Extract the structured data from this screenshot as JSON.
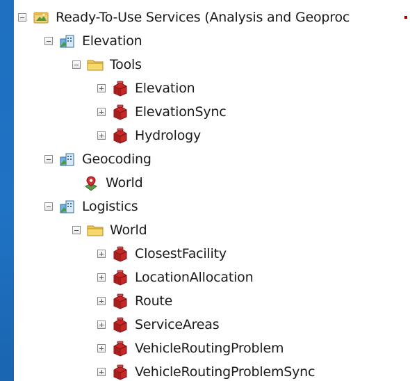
{
  "tree": {
    "root": {
      "label": "Ready-To-Use Services (Analysis and Geoproc",
      "icon": "server-connection-icon",
      "expanded": true
    },
    "folders": [
      {
        "label": "Elevation",
        "icon": "service-folder-icon",
        "expanded": true,
        "subfolder": {
          "label": "Tools",
          "icon": "folder-icon",
          "expanded": true,
          "items": [
            {
              "label": "Elevation",
              "icon": "toolbox-icon"
            },
            {
              "label": "ElevationSync",
              "icon": "toolbox-icon"
            },
            {
              "label": "Hydrology",
              "icon": "toolbox-icon"
            }
          ]
        }
      },
      {
        "label": "Geocoding",
        "icon": "service-folder-icon",
        "expanded": true,
        "items": [
          {
            "label": "World",
            "icon": "geocode-locator-icon"
          }
        ]
      },
      {
        "label": "Logistics",
        "icon": "service-folder-icon",
        "expanded": true,
        "subfolder": {
          "label": "World",
          "icon": "folder-icon",
          "expanded": true,
          "items": [
            {
              "label": "ClosestFacility",
              "icon": "toolbox-icon"
            },
            {
              "label": "LocationAllocation",
              "icon": "toolbox-icon"
            },
            {
              "label": "Route",
              "icon": "toolbox-icon"
            },
            {
              "label": "ServiceAreas",
              "icon": "toolbox-icon"
            },
            {
              "label": "VehicleRoutingProblem",
              "icon": "toolbox-icon"
            },
            {
              "label": "VehicleRoutingProblemSync",
              "icon": "toolbox-icon"
            }
          ]
        }
      }
    ]
  },
  "colors": {
    "background": "#1f6fbd",
    "panel": "#ffffff",
    "text": "#1a1a1a",
    "toolbox_red": "#c62828",
    "folder_yellow": "#f2c94c"
  }
}
